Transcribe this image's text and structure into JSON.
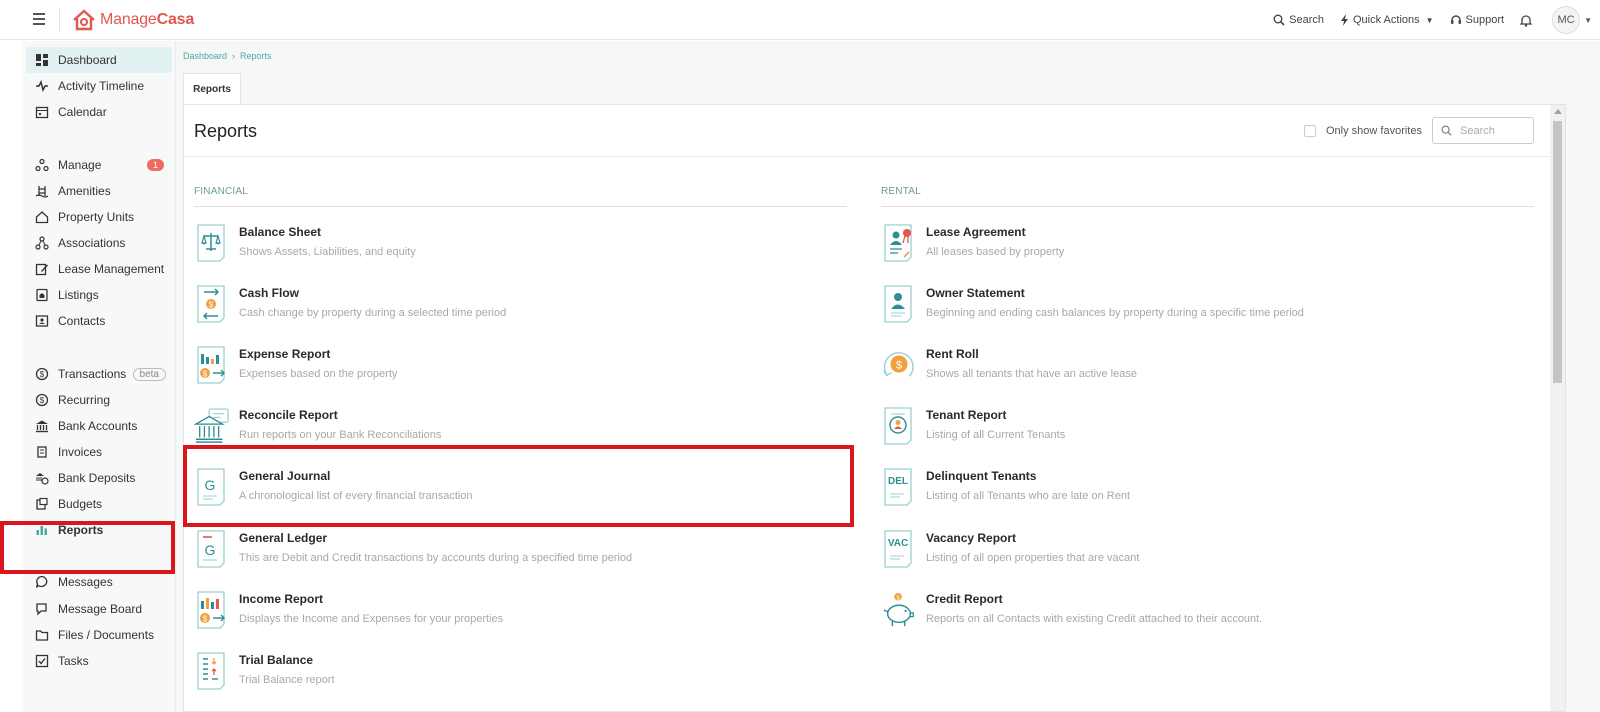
{
  "topbar": {
    "logo_regular": "Manage",
    "logo_bold": "Casa",
    "search_label": "Search",
    "quick_actions_label": "Quick Actions",
    "support_label": "Support",
    "avatar_initials": "MC"
  },
  "sidebar": {
    "items": [
      {
        "label": "Dashboard",
        "icon": "dashboard-icon"
      },
      {
        "label": "Activity Timeline",
        "icon": "activity-icon"
      },
      {
        "label": "Calendar",
        "icon": "calendar-icon"
      },
      {
        "label": "Manage",
        "icon": "manage-icon",
        "badge": "1"
      },
      {
        "label": "Amenities",
        "icon": "amenities-icon"
      },
      {
        "label": "Property Units",
        "icon": "home-icon"
      },
      {
        "label": "Associations",
        "icon": "associations-icon"
      },
      {
        "label": "Lease Management",
        "icon": "edit-icon"
      },
      {
        "label": "Listings",
        "icon": "listings-icon"
      },
      {
        "label": "Contacts",
        "icon": "contacts-icon"
      },
      {
        "label": "Transactions",
        "icon": "dollar-icon",
        "tag": "beta"
      },
      {
        "label": "Recurring",
        "icon": "recurring-icon"
      },
      {
        "label": "Bank Accounts",
        "icon": "bank-icon"
      },
      {
        "label": "Invoices",
        "icon": "invoices-icon"
      },
      {
        "label": "Bank Deposits",
        "icon": "deposits-icon"
      },
      {
        "label": "Budgets",
        "icon": "budgets-icon"
      },
      {
        "label": "Reports",
        "icon": "bar-chart-icon"
      },
      {
        "label": "Messages",
        "icon": "chat-icon"
      },
      {
        "label": "Message Board",
        "icon": "message-board-icon"
      },
      {
        "label": "Files / Documents",
        "icon": "folder-icon"
      },
      {
        "label": "Tasks",
        "icon": "tasks-icon"
      }
    ]
  },
  "breadcrumb": {
    "items": [
      "Dashboard",
      "Reports"
    ]
  },
  "tab_label": "Reports",
  "page_title": "Reports",
  "favorites_label": "Only show favorites",
  "search_placeholder": "Search",
  "sections": {
    "financial": {
      "title": "FINANCIAL",
      "reports": [
        {
          "name": "Balance Sheet",
          "desc": "Shows Assets, Liabilities, and equity",
          "icon": "scale-icon"
        },
        {
          "name": "Cash Flow",
          "desc": "Cash change by property during a selected time period",
          "icon": "cash-flow-icon"
        },
        {
          "name": "Expense Report",
          "desc": "Expenses based on the property",
          "icon": "expense-chart-icon"
        },
        {
          "name": "Reconcile Report",
          "desc": "Run reports on your Bank Reconciliations",
          "icon": "bank-building-icon"
        },
        {
          "name": "General Journal",
          "desc": "A chronological list of every financial transaction",
          "icon": "journal-g-icon"
        },
        {
          "name": "General Ledger",
          "desc": "This are Debit and Credit transactions by accounts during a specified time period",
          "icon": "ledger-g-icon"
        },
        {
          "name": "Income Report",
          "desc": "Displays the Income and Expenses for your properties",
          "icon": "income-chart-icon"
        },
        {
          "name": "Trial Balance",
          "desc": "Trial Balance report",
          "icon": "trial-balance-icon"
        }
      ]
    },
    "rental": {
      "title": "RENTAL",
      "reports": [
        {
          "name": "Lease Agreement",
          "desc": "All leases based by property",
          "icon": "lease-doc-icon"
        },
        {
          "name": "Owner Statement",
          "desc": "Beginning and ending cash balances by property during a specific time period",
          "icon": "owner-doc-icon"
        },
        {
          "name": "Rent Roll",
          "desc": "Shows all tenants that have an active lease",
          "icon": "rent-roll-icon"
        },
        {
          "name": "Tenant Report",
          "desc": "Listing of all Current Tenants",
          "icon": "tenant-doc-icon"
        },
        {
          "name": "Delinquent Tenants",
          "desc": "Listing of all Tenants who are late on Rent",
          "icon": "del-doc-icon",
          "icon_text": "DEL"
        },
        {
          "name": "Vacancy Report",
          "desc": "Listing of all open properties that are vacant",
          "icon": "vac-doc-icon",
          "icon_text": "VAC"
        },
        {
          "name": "Credit Report",
          "desc": "Reports on all Contacts with existing Credit attached to their account.",
          "icon": "piggy-bank-icon"
        }
      ]
    }
  },
  "colors": {
    "brand": "#e0584f",
    "accent": "#4fa7a3",
    "icon_teal": "#2e8e96",
    "icon_orange": "#f0a03c",
    "highlight": "#d9161b",
    "badge": "#ef6b5b"
  }
}
